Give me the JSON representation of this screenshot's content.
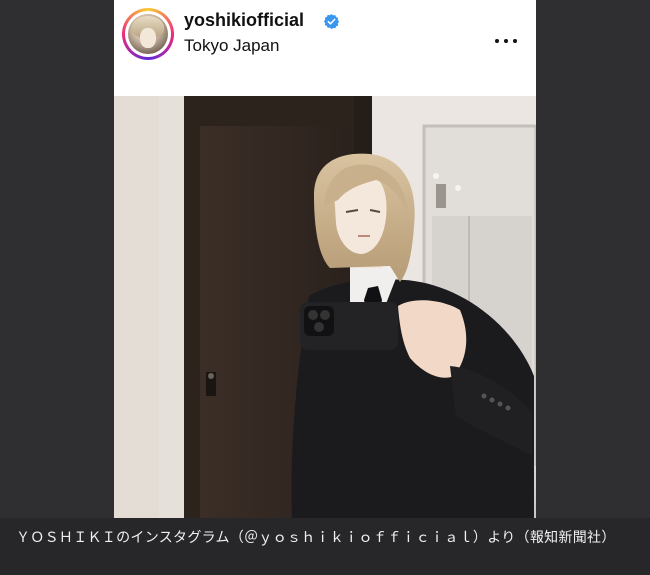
{
  "post": {
    "username": "yoshikiofficial",
    "location": "Tokyo Japan",
    "verified": true,
    "icons": {
      "verified": "verified-badge-icon",
      "more": "more-options-icon",
      "avatar": "profile-avatar"
    },
    "colors": {
      "verified_badge": "#3897f0",
      "header_bg": "#ffffff"
    }
  },
  "caption": {
    "text": "ＹＯＳＨＩＫＩのインスタグラム（＠ｙｏｓｈｉｋｉｏｆｆｉｃｉａｌ）より（報知新聞社）"
  }
}
